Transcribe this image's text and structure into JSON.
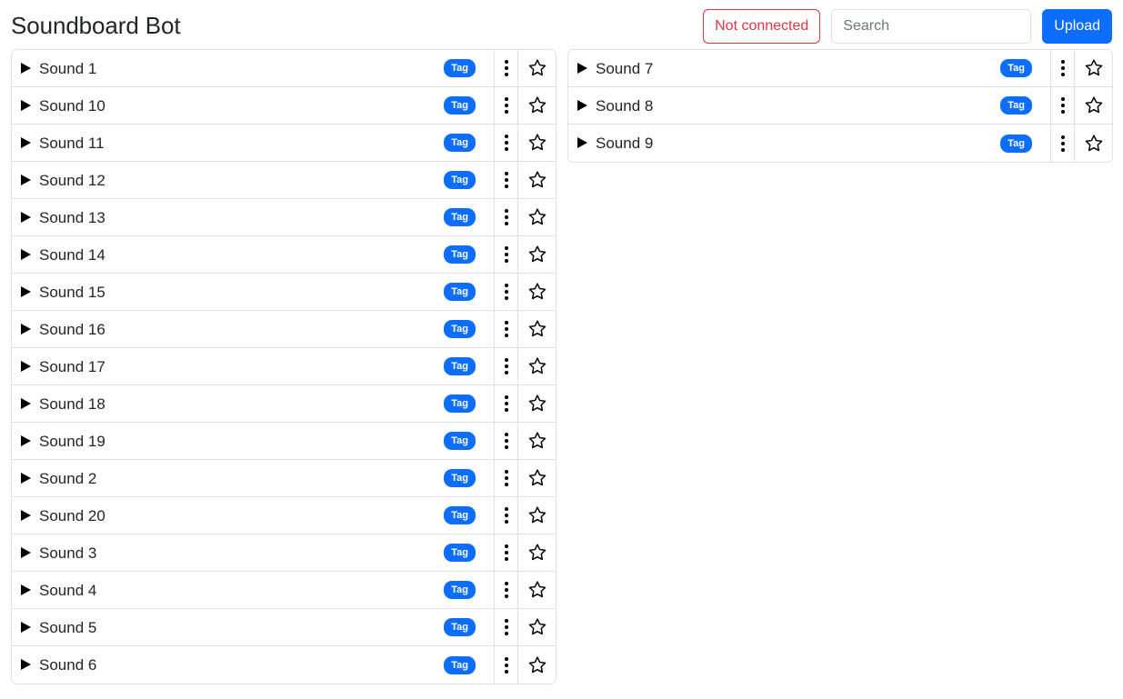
{
  "header": {
    "title": "Soundboard Bot",
    "connection_status_label": "Not connected",
    "connection_status_color": "#dc3545",
    "search_placeholder": "Search",
    "search_value": "",
    "upload_label": "Upload",
    "upload_color": "#0d6efd"
  },
  "theme": {
    "accent": "#0d6efd",
    "danger": "#dc3545",
    "border": "#dee2e6",
    "text": "#212529",
    "muted": "#6c757d"
  },
  "icons": {
    "play": "play-icon",
    "menu": "kebab-menu-icon",
    "favorite": "star-outline-icon"
  },
  "columns": [
    {
      "name": "left-column",
      "rows": [
        {
          "name": "Sound 1",
          "tag": "Tag"
        },
        {
          "name": "Sound 10",
          "tag": "Tag"
        },
        {
          "name": "Sound 11",
          "tag": "Tag"
        },
        {
          "name": "Sound 12",
          "tag": "Tag"
        },
        {
          "name": "Sound 13",
          "tag": "Tag"
        },
        {
          "name": "Sound 14",
          "tag": "Tag"
        },
        {
          "name": "Sound 15",
          "tag": "Tag"
        },
        {
          "name": "Sound 16",
          "tag": "Tag"
        },
        {
          "name": "Sound 17",
          "tag": "Tag"
        },
        {
          "name": "Sound 18",
          "tag": "Tag"
        },
        {
          "name": "Sound 19",
          "tag": "Tag"
        },
        {
          "name": "Sound 2",
          "tag": "Tag"
        },
        {
          "name": "Sound 20",
          "tag": "Tag"
        },
        {
          "name": "Sound 3",
          "tag": "Tag"
        },
        {
          "name": "Sound 4",
          "tag": "Tag"
        },
        {
          "name": "Sound 5",
          "tag": "Tag"
        },
        {
          "name": "Sound 6",
          "tag": "Tag"
        }
      ]
    },
    {
      "name": "right-column",
      "rows": [
        {
          "name": "Sound 7",
          "tag": "Tag"
        },
        {
          "name": "Sound 8",
          "tag": "Tag"
        },
        {
          "name": "Sound 9",
          "tag": "Tag"
        }
      ]
    }
  ]
}
